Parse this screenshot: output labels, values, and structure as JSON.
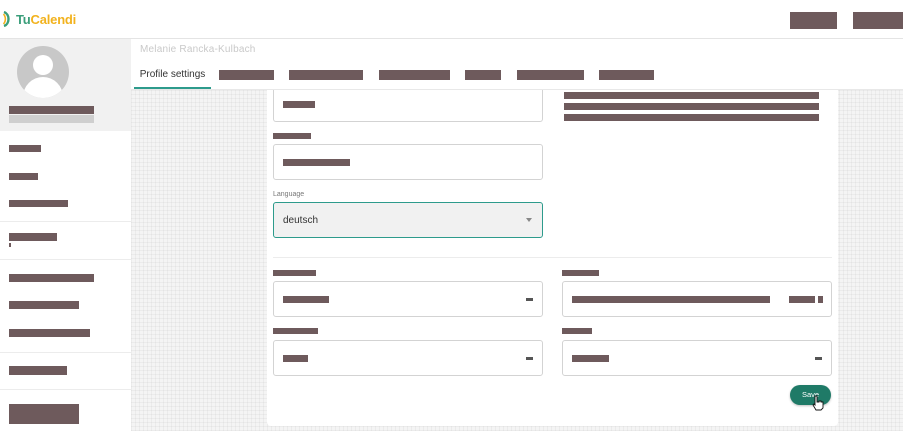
{
  "app": {
    "logo_part1": "Tu",
    "logo_part2": "Calendi"
  },
  "header": {
    "user_name": "Melanie Rancka-Kulbach"
  },
  "tabs": {
    "active": "Profile settings"
  },
  "form": {
    "language_label": "Language",
    "language_value": "deutsch",
    "save_label": "Save"
  },
  "colors": {
    "accent": "#2d9b8c",
    "save_button": "#1f7a67",
    "redaction": "#6e5a5c"
  },
  "icons": [
    "avatar-placeholder-icon",
    "chevron-down-icon",
    "minus-icon",
    "pointer-cursor-icon"
  ]
}
